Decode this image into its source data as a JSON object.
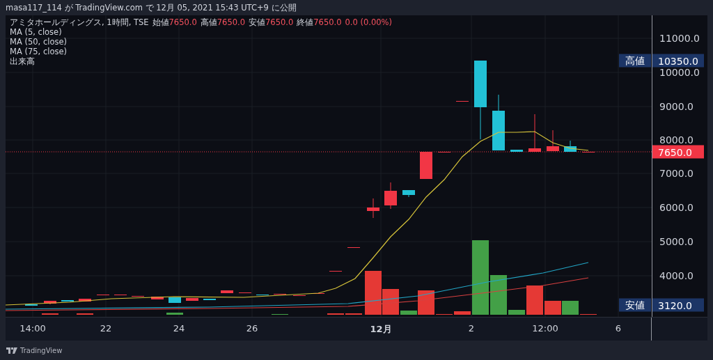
{
  "header": {
    "text": "masa117_114 が TradingView.com で 12月 05, 2021 15:43 UTC+9 に公開"
  },
  "legend": {
    "symbol": "アミタホールディングス, 1時間, TSE",
    "ohlc": [
      {
        "label": "始値",
        "value": "7650.0"
      },
      {
        "label": "高値",
        "value": "7650.0"
      },
      {
        "label": "安値",
        "value": "7650.0"
      },
      {
        "label": "終値",
        "value": "7650.0"
      }
    ],
    "change": "0.0 (0.00%)",
    "indicators": [
      "MA (5, close)",
      "MA (50, close)",
      "MA (75, close)",
      "出来高"
    ]
  },
  "price_axis": {
    "ticks": [
      "11000.0",
      "10000.0",
      "9000.0",
      "8000.0",
      "7000.0",
      "6000.0",
      "5000.0",
      "4000.0"
    ],
    "high_tag": {
      "label": "高値",
      "value": "10350.0"
    },
    "last_price": "7650.0",
    "low_tag": {
      "label": "安値",
      "value": "3120.0"
    }
  },
  "time_axis": {
    "labels": [
      {
        "text": "14:00",
        "kind": "time"
      },
      {
        "text": "22",
        "kind": "day"
      },
      {
        "text": "24",
        "kind": "day"
      },
      {
        "text": "26",
        "kind": "day"
      },
      {
        "text": "12月",
        "kind": "month"
      },
      {
        "text": "2",
        "kind": "day"
      },
      {
        "text": "12:00",
        "kind": "time"
      },
      {
        "text": "6",
        "kind": "day"
      }
    ]
  },
  "footer": {
    "brand": "TradingView"
  }
}
